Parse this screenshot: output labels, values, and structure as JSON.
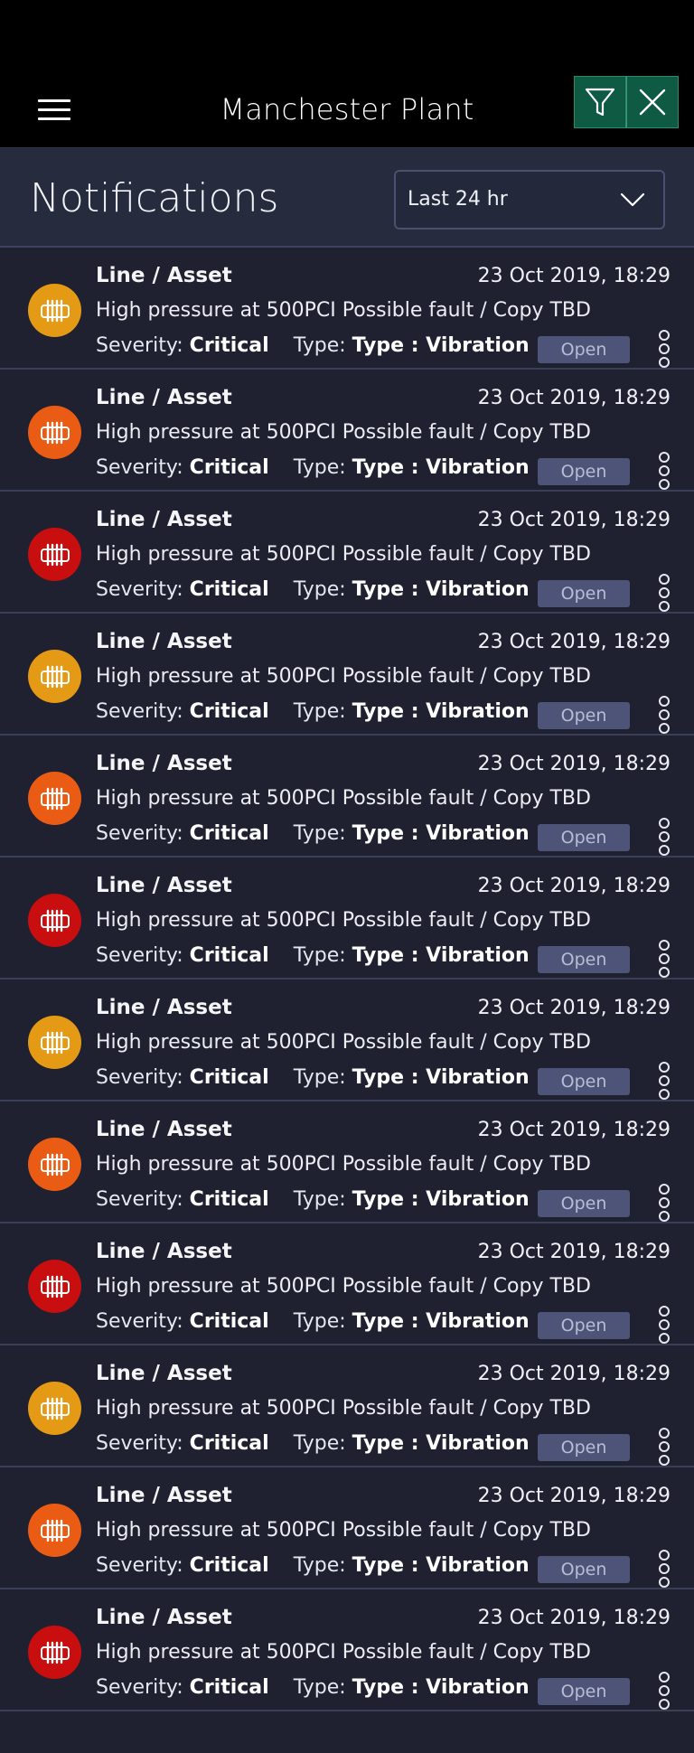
{
  "app": {
    "title": "Manchester Plant"
  },
  "header": {
    "title": "Notifications",
    "filter": {
      "selected": "Last 24 hr"
    }
  },
  "icons": {
    "menu": "hamburger-menu-icon",
    "filter": "funnel-filter-icon",
    "close": "close-icon",
    "chevron": "chevron-down-icon",
    "asset": "radiator-asset-icon",
    "more": "more-options-icon"
  },
  "colors": {
    "yellow": "#e49a15",
    "orange": "#ea5b14",
    "red": "#c80e0e",
    "accent_button": "#0e5a43"
  },
  "notifications": [
    {
      "asset": "Line / Asset",
      "timestamp": "23 Oct 2019, 18:29",
      "message": "High pressure at 500PCI Possible fault / Copy TBD",
      "severity_label": "Severity:",
      "severity": "Critical",
      "type_label": "Type:",
      "type": "Type : Vibration",
      "status": "Open",
      "level": "yellow"
    },
    {
      "asset": "Line / Asset",
      "timestamp": "23 Oct 2019, 18:29",
      "message": "High pressure at 500PCI Possible fault / Copy TBD",
      "severity_label": "Severity:",
      "severity": "Critical",
      "type_label": "Type:",
      "type": "Type : Vibration",
      "status": "Open",
      "level": "orange"
    },
    {
      "asset": "Line / Asset",
      "timestamp": "23 Oct 2019, 18:29",
      "message": "High pressure at 500PCI Possible fault / Copy TBD",
      "severity_label": "Severity:",
      "severity": "Critical",
      "type_label": "Type:",
      "type": "Type : Vibration",
      "status": "Open",
      "level": "red"
    },
    {
      "asset": "Line / Asset",
      "timestamp": "23 Oct 2019, 18:29",
      "message": "High pressure at 500PCI Possible fault / Copy TBD",
      "severity_label": "Severity:",
      "severity": "Critical",
      "type_label": "Type:",
      "type": "Type : Vibration",
      "status": "Open",
      "level": "yellow"
    },
    {
      "asset": "Line / Asset",
      "timestamp": "23 Oct 2019, 18:29",
      "message": "High pressure at 500PCI Possible fault / Copy TBD",
      "severity_label": "Severity:",
      "severity": "Critical",
      "type_label": "Type:",
      "type": "Type : Vibration",
      "status": "Open",
      "level": "orange"
    },
    {
      "asset": "Line / Asset",
      "timestamp": "23 Oct 2019, 18:29",
      "message": "High pressure at 500PCI Possible fault / Copy TBD",
      "severity_label": "Severity:",
      "severity": "Critical",
      "type_label": "Type:",
      "type": "Type : Vibration",
      "status": "Open",
      "level": "red"
    },
    {
      "asset": "Line / Asset",
      "timestamp": "23 Oct 2019, 18:29",
      "message": "High pressure at 500PCI Possible fault / Copy TBD",
      "severity_label": "Severity:",
      "severity": "Critical",
      "type_label": "Type:",
      "type": "Type : Vibration",
      "status": "Open",
      "level": "yellow"
    },
    {
      "asset": "Line / Asset",
      "timestamp": "23 Oct 2019, 18:29",
      "message": "High pressure at 500PCI Possible fault / Copy TBD",
      "severity_label": "Severity:",
      "severity": "Critical",
      "type_label": "Type:",
      "type": "Type : Vibration",
      "status": "Open",
      "level": "orange"
    },
    {
      "asset": "Line / Asset",
      "timestamp": "23 Oct 2019, 18:29",
      "message": "High pressure at 500PCI Possible fault / Copy TBD",
      "severity_label": "Severity:",
      "severity": "Critical",
      "type_label": "Type:",
      "type": "Type : Vibration",
      "status": "Open",
      "level": "red"
    },
    {
      "asset": "Line / Asset",
      "timestamp": "23 Oct 2019, 18:29",
      "message": "High pressure at 500PCI Possible fault / Copy TBD",
      "severity_label": "Severity:",
      "severity": "Critical",
      "type_label": "Type:",
      "type": "Type : Vibration",
      "status": "Open",
      "level": "yellow"
    },
    {
      "asset": "Line / Asset",
      "timestamp": "23 Oct 2019, 18:29",
      "message": "High pressure at 500PCI Possible fault / Copy TBD",
      "severity_label": "Severity:",
      "severity": "Critical",
      "type_label": "Type:",
      "type": "Type : Vibration",
      "status": "Open",
      "level": "orange"
    },
    {
      "asset": "Line / Asset",
      "timestamp": "23 Oct 2019, 18:29",
      "message": "High pressure at 500PCI Possible fault / Copy TBD",
      "severity_label": "Severity:",
      "severity": "Critical",
      "type_label": "Type:",
      "type": "Type : Vibration",
      "status": "Open",
      "level": "red"
    }
  ]
}
